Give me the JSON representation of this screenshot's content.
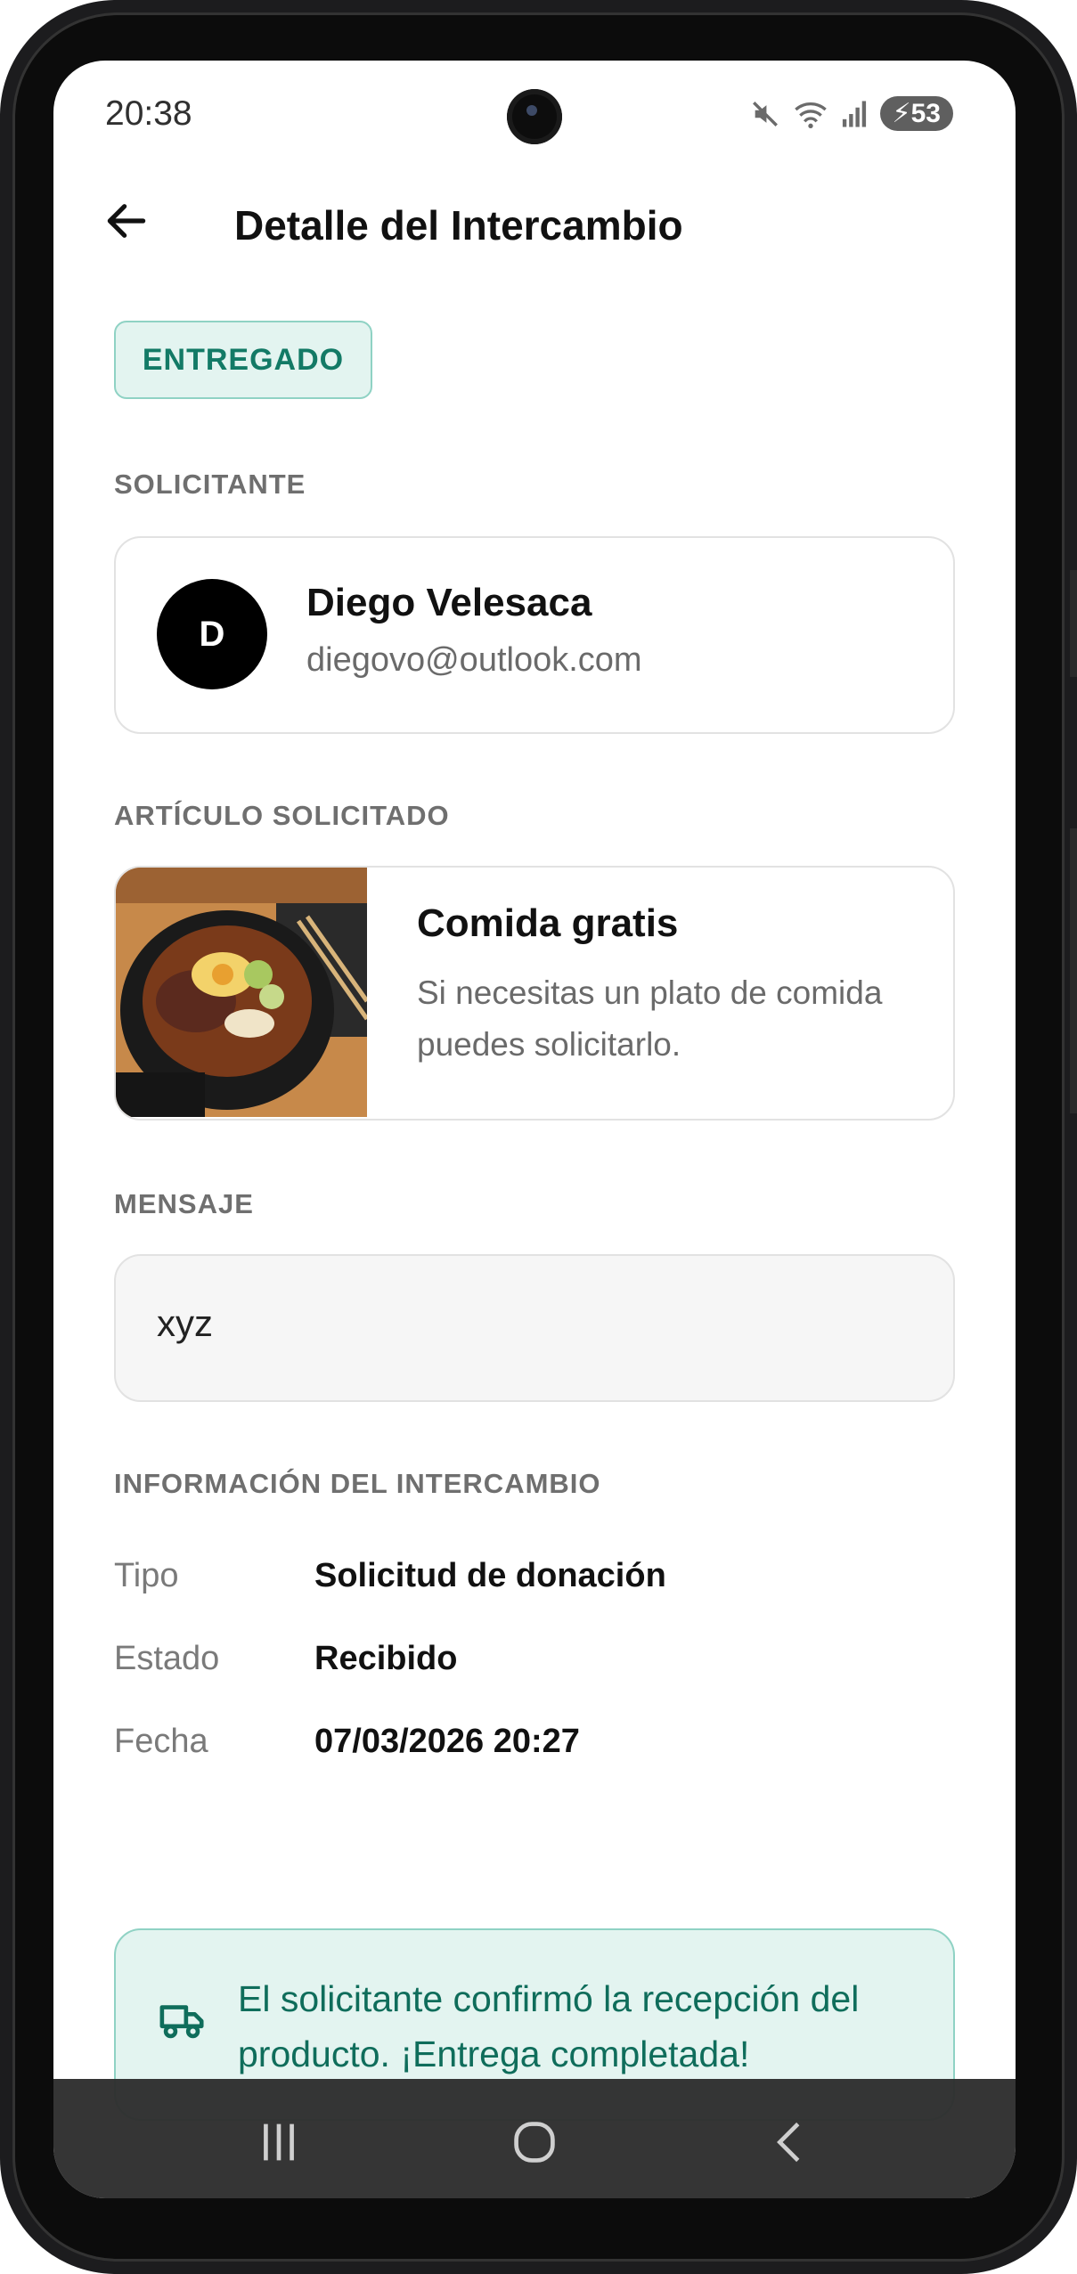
{
  "status_bar": {
    "time": "20:38",
    "battery": "53"
  },
  "appbar": {
    "title": "Detalle del Intercambio"
  },
  "badge": {
    "label": "ENTREGADO"
  },
  "requester": {
    "section_label": "SOLICITANTE",
    "avatar_initial": "D",
    "name": "Diego Velesaca",
    "email": "diegovo@outlook.com"
  },
  "item": {
    "section_label": "ARTÍCULO SOLICITADO",
    "title": "Comida gratis",
    "description": "Si necesitas un plato de comida puedes solicitarlo."
  },
  "message": {
    "section_label": "MENSAJE",
    "text": "xyz"
  },
  "exchange_info": {
    "section_label": "INFORMACIÓN DEL INTERCAMBIO",
    "rows": [
      {
        "label": "Tipo",
        "value": "Solicitud de donación"
      },
      {
        "label": "Estado",
        "value": "Recibido"
      },
      {
        "label": "Fecha",
        "value": "07/03/2026  20:27"
      }
    ]
  },
  "notice": {
    "text": "El solicitante confirmó la recepción del producto. ¡Entrega completada!"
  },
  "colors": {
    "accent": "#137a66",
    "accent_bg": "#e3f4f0",
    "accent_border": "#8fd2c4"
  },
  "icons": [
    "back-arrow-icon",
    "mute-icon",
    "wifi-icon",
    "signal-icon",
    "battery-icon",
    "truck-icon",
    "recents-icon",
    "home-icon",
    "nav-back-icon"
  ]
}
